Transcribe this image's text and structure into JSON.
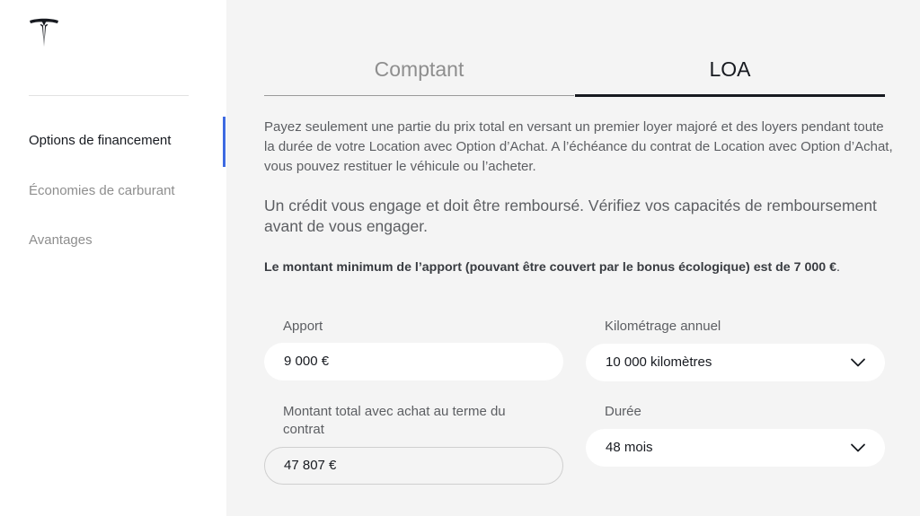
{
  "sidebar": {
    "items": [
      {
        "label": "Options de financement",
        "active": true
      },
      {
        "label": "Économies de carburant",
        "active": false
      },
      {
        "label": "Avantages",
        "active": false
      }
    ],
    "accent_color": "#3e6ae1"
  },
  "tabs": [
    {
      "label": "Comptant",
      "active": false
    },
    {
      "label": "LOA",
      "active": true
    }
  ],
  "content": {
    "description": "Payez seulement une partie du prix total en versant un premier loyer majoré et des loyers pendant toute la durée de votre Location avec Option d’Achat. A l’échéance du contrat de Location avec Option d’Achat, vous pouvez restituer le véhicule ou l’acheter.",
    "warning": "Un crédit vous engage et doit être remboursé. Vérifiez vos capacités de remboursement avant de vous engager.",
    "minimum_bold": "Le montant minimum de l’apport (pouvant être couvert par le bonus écologique) est de 7 000 €",
    "minimum_end": "."
  },
  "form": {
    "apport": {
      "label": "Apport",
      "value": "9 000 €"
    },
    "kilometrage": {
      "label": "Kilométrage annuel",
      "value": "10 000 kilomètres"
    },
    "montant_total": {
      "label": "Montant total avec achat au terme du contrat",
      "value": "47 807 €"
    },
    "duree": {
      "label": "Durée",
      "value": "48 mois"
    }
  },
  "icons": {
    "logo": "tesla-logo-icon",
    "dropdown": "chevron-down-icon"
  }
}
